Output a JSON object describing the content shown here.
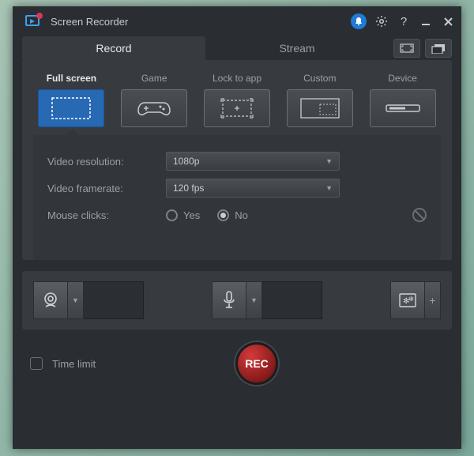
{
  "app": {
    "title": "Screen Recorder"
  },
  "tabs": {
    "record": "Record",
    "stream": "Stream"
  },
  "sources": {
    "fullscreen": "Full screen",
    "game": "Game",
    "lock": "Lock to app",
    "custom": "Custom",
    "device": "Device"
  },
  "settings": {
    "resolution_label": "Video resolution:",
    "resolution_value": "1080p",
    "framerate_label": "Video framerate:",
    "framerate_value": "120 fps",
    "mouse_label": "Mouse clicks:",
    "yes": "Yes",
    "no": "No"
  },
  "footer": {
    "timelimit": "Time limit",
    "rec": "REC"
  }
}
